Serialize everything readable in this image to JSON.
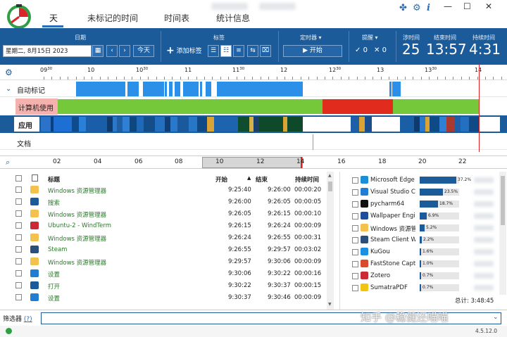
{
  "nav": {
    "tabs": [
      {
        "label": "天",
        "active": true
      },
      {
        "label": "未标记的时间",
        "active": false
      },
      {
        "label": "时间表",
        "active": false
      },
      {
        "label": "统计信息",
        "active": false
      }
    ]
  },
  "window": {
    "minimize": "—",
    "maximize": "☐",
    "close": "✕"
  },
  "toolbar": {
    "date_label": "日期",
    "date_value": "星期二, 8月15日 2023",
    "calendar_icon": "calendar-icon",
    "prev": "‹",
    "next": "›",
    "today": "今天",
    "tags_label": "标签",
    "add_tag": "添加标签",
    "timer_label": "定时器 ▾",
    "start": "开始",
    "remind_label": "提醒 ▾",
    "remind_ok": "0",
    "remind_cancel": "0",
    "elapsed_label": "涉时间",
    "elapsed_value": "25",
    "end_label": "结束时间",
    "end_value": "13:57",
    "duration_label": "持续时间",
    "duration_value": "4:31"
  },
  "ruler": {
    "labels": [
      {
        "hour": "09",
        "min": "30"
      },
      {
        "hour": "10",
        "min": ""
      },
      {
        "hour": "10",
        "min": "30"
      },
      {
        "hour": "11",
        "min": ""
      },
      {
        "hour": "11",
        "min": "30"
      },
      {
        "hour": "12",
        "min": ""
      },
      {
        "hour": "12",
        "min": "30"
      },
      {
        "hour": "13",
        "min": ""
      },
      {
        "hour": "13",
        "min": "30"
      },
      {
        "hour": "14",
        "min": ""
      }
    ]
  },
  "rows": {
    "auto": "自动标记",
    "usage": "计算机使用",
    "apps": "应用",
    "docs": "文档"
  },
  "overview": {
    "labels": [
      "02",
      "04",
      "06",
      "08",
      "10",
      "12",
      "14",
      "16",
      "18",
      "20",
      "22"
    ]
  },
  "table": {
    "headers": {
      "title": "标题",
      "start": "开始",
      "end": "结束",
      "duration": "持续时间"
    },
    "rows": [
      {
        "title": "Windows 资源管理器",
        "start": "9:25:40",
        "end": "9:26:00",
        "duration": "00:00:20",
        "icon": "folder-icon"
      },
      {
        "title": "搜索",
        "start": "9:26:00",
        "end": "9:26:05",
        "duration": "00:00:05",
        "icon": "search-app-icon"
      },
      {
        "title": "Windows 资源管理器",
        "start": "9:26:05",
        "end": "9:26:15",
        "duration": "00:00:10",
        "icon": "folder-icon"
      },
      {
        "title": "Ubuntu-2 - WindTerm",
        "start": "9:26:15",
        "end": "9:26:24",
        "duration": "00:00:09",
        "icon": "terminal-icon"
      },
      {
        "title": "Windows 资源管理器",
        "start": "9:26:24",
        "end": "9:26:55",
        "duration": "00:00:31",
        "icon": "folder-icon"
      },
      {
        "title": "Steam",
        "start": "9:26:55",
        "end": "9:29:57",
        "duration": "00:03:02",
        "icon": "steam-icon"
      },
      {
        "title": "Windows 资源管理器",
        "start": "9:29:57",
        "end": "9:30:06",
        "duration": "00:00:09",
        "icon": "folder-icon"
      },
      {
        "title": "设置",
        "start": "9:30:06",
        "end": "9:30:22",
        "duration": "00:00:16",
        "icon": "settings-app-icon"
      },
      {
        "title": "打开",
        "start": "9:30:22",
        "end": "9:30:37",
        "duration": "00:00:15",
        "icon": "open-dialog-icon"
      },
      {
        "title": "设置",
        "start": "9:30:37",
        "end": "9:30:46",
        "duration": "00:00:09",
        "icon": "settings-app-icon"
      }
    ]
  },
  "apps": {
    "items": [
      {
        "name": "Microsoft Edge",
        "percent": 37.2,
        "label": "37.2%",
        "icon": "edge-icon",
        "color": "#1a8fd6"
      },
      {
        "name": "Visual Studio C",
        "percent": 23.5,
        "label": "23.5%",
        "icon": "vscode-icon",
        "color": "#1f7ed1"
      },
      {
        "name": "pycharm64",
        "percent": 18.7,
        "label": "18.7%",
        "icon": "pycharm-icon",
        "color": "#111111"
      },
      {
        "name": "Wallpaper Engi",
        "percent": 6.9,
        "label": "6.9%",
        "icon": "wallpaper-engine-icon",
        "color": "#1f4f9a"
      },
      {
        "name": "Windows 资源管理",
        "percent": 5.2,
        "label": "5.2%",
        "icon": "folder-icon",
        "color": "#f2c14e"
      },
      {
        "name": "Steam Client W",
        "percent": 2.2,
        "label": "2.2%",
        "icon": "steam-icon",
        "color": "#2a4f7a"
      },
      {
        "name": "KuGou",
        "percent": 1.6,
        "label": "1.6%",
        "icon": "kugou-icon",
        "color": "#1b8fe0"
      },
      {
        "name": "FastStone Capt",
        "percent": 1.0,
        "label": "1.0%",
        "icon": "faststone-icon",
        "color": "#d94b2b"
      },
      {
        "name": "Zotero",
        "percent": 0.7,
        "label": "0.7%",
        "icon": "zotero-icon",
        "color": "#cc2936"
      },
      {
        "name": "SumatraPDF",
        "percent": 0.7,
        "label": "0.7%",
        "icon": "sumatra-icon",
        "color": "#f1c40f"
      }
    ],
    "total": "总计: 3:48:45"
  },
  "filter": {
    "label": "筛选器",
    "help": "(?)",
    "value": ""
  },
  "status": {
    "version": "4.5.12.0"
  },
  "watermark": "知乎 @稳健还喵喵"
}
